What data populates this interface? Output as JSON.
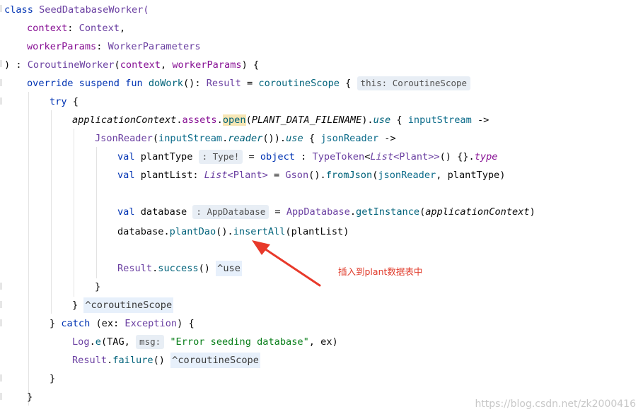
{
  "code": {
    "l1": {
      "a": "class",
      "b": "SeedDatabaseWorker("
    },
    "l2": {
      "a": "context",
      "b": ": ",
      "c": "Context",
      "d": ","
    },
    "l3": {
      "a": "workerParams",
      "b": ": ",
      "c": "WorkerParameters"
    },
    "l4": {
      "a": ") : ",
      "b": "CoroutineWorker",
      "c": "(",
      "d": "context",
      "e": ", ",
      "f": "workerParams",
      "g": ") {"
    },
    "l5": {
      "a": "override suspend fun",
      "b": "doWork",
      "c": "(): ",
      "d": "Result",
      "e": " = ",
      "f": "coroutineScope",
      "g": " {",
      "hint": "this: CoroutineScope"
    },
    "l6": {
      "a": "try",
      "b": " {"
    },
    "l7": {
      "a": "applicationContext",
      "b": ".",
      "c": "assets",
      "d": ".",
      "e": "open",
      "f": "(",
      "g": "PLANT_DATA_FILENAME",
      "h": ").",
      "i": "use",
      "j": " { ",
      "k": "inputStream",
      "l": " ->"
    },
    "l8": {
      "a": "JsonReader",
      "b": "(",
      "c": "inputStream",
      "d": ".",
      "e": "reader",
      "f": "()).",
      "g": "use",
      "h": " { ",
      "i": "jsonReader",
      "j": " ->"
    },
    "l9": {
      "a": "val",
      "b": " plantType ",
      "hint": ": Type!",
      "c": " = ",
      "d": "object",
      "e": " : ",
      "f": "TypeToken",
      "g": "<",
      "h": "List",
      "i": "<Plant>>",
      "j": "() {}.",
      "k": "type"
    },
    "l10": {
      "a": "val",
      "b": " plantList: ",
      "c": "List",
      "d": "<Plant>",
      "e": " = ",
      "f": "Gson",
      "g": "().",
      "h": "fromJson",
      "i": "(",
      "j": "jsonReader",
      "k": ", plantType)"
    },
    "l11": {
      "a": "val",
      "b": " database ",
      "hint": ": AppDatabase",
      "c": " = ",
      "d": "AppDatabase",
      "e": ".",
      "f": "getInstance",
      "g": "(",
      "h": "applicationContext",
      "i": ")"
    },
    "l12": {
      "a": "database.",
      "b": "plantDao",
      "c": "().",
      "d": "insertAll",
      "e": "(plantList)"
    },
    "l13": {
      "a": "Result",
      "b": ".",
      "c": "success",
      "d": "() ",
      "e": "^use"
    },
    "l14": {
      "a": "}"
    },
    "l15": {
      "a": "} ",
      "b": "^coroutineScope"
    },
    "l16": {
      "a": "} ",
      "b": "catch",
      "c": " (ex: ",
      "d": "Exception",
      "e": ") {"
    },
    "l17": {
      "a": "Log",
      "b": ".",
      "c": "e",
      "d": "(TAG, ",
      "hint": "msg:",
      "e": "\"Error seeding database\"",
      "f": ", ex)"
    },
    "l18": {
      "a": "Result",
      "b": ".",
      "c": "failure",
      "d": "() ",
      "e": "^coroutineScope"
    },
    "l19": {
      "a": "}"
    },
    "l20": {
      "a": "}"
    }
  },
  "annotation": {
    "text": "插入到plant数据表中",
    "color": "#e03a2a"
  },
  "watermark": {
    "text": "https://blog.csdn.net/zk2000416"
  }
}
